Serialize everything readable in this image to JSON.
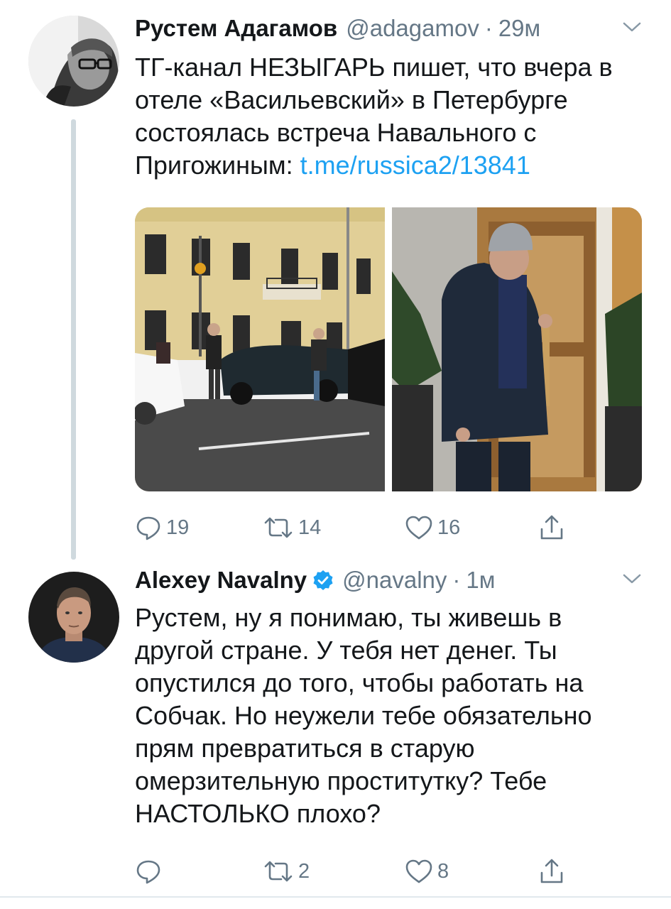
{
  "tweets": [
    {
      "author_name": "Рустем Адагамов",
      "handle": "@adagamov",
      "separator": "·",
      "time": "29м",
      "avatar_icon": "avatar-photo",
      "text_before_link": "ТГ-канал НЕЗЫГАРЬ пишет, что вчера в отеле «Васильевский» в Петербурге состоялась встреча Навального с Пригожиным: ",
      "link": "t.me/russica2/13841",
      "media_icons": [
        "street-photo",
        "doorway-photo"
      ],
      "replies": "19",
      "retweets": "14",
      "likes": "16"
    },
    {
      "author_name": "Alexey Navalny",
      "verified_icon": "verified-badge-icon",
      "handle": "@navalny",
      "separator": "·",
      "time": "1м",
      "avatar_icon": "avatar-photo",
      "text": "Рустем, ну я понимаю, ты живешь в другой стране. У тебя нет денег. Ты опустился до того, чтобы работать на Собчак. Но неужели тебе обязательно прям превратиться в старую омерзительную проститутку? Тебе НАСТОЛЬКО плохо?",
      "replies": "",
      "retweets": "2",
      "likes": "8"
    }
  ],
  "colors": {
    "text": "#14171a",
    "secondary": "#657786",
    "link": "#1da1f2",
    "thread_line": "#cfd9de"
  }
}
